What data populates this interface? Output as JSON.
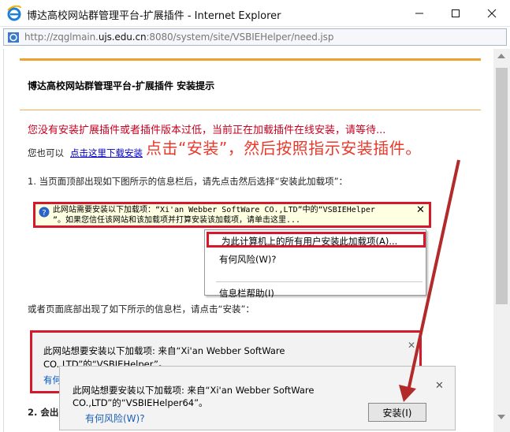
{
  "window": {
    "title": "博达高校网站群管理平台-扩展插件 - Internet Explorer",
    "address_url_prefix": "http://zqglmain.",
    "address_url_host": "ujs.edu.cn",
    "address_url_rest": ":8080/system/site/VSBIEHelper/need.jsp"
  },
  "page": {
    "header_title": "博达高校网站群管理平台-扩展插件 安装提示",
    "warning": "您没有安装扩展插件或者插件版本过低，当前正在加载插件在线安装，请等待...",
    "also_prefix": "您也可以",
    "download_link": "点击这里下载安装",
    "annotation": "点击“安装”，然后按照指示安装插件。",
    "step1": "1. 当页面顶部出现如下图所示的信息栏后，请先点击然后选择“安装此加载项”：",
    "or_bottom": "或者页面底部出现了如下所示的信息栏，请点击“安装”：",
    "step2_partial": "2. 会出"
  },
  "infobar1": {
    "line1": "此网站需要安装以下加载项：“Xi'an Webber SoftWare CO.,LTD”中的“VSBIEHelper",
    "line2": "”。如果您信任该网站和该加载项并打算安装该加载项，请单击这里...",
    "close": "✕"
  },
  "context_menu": {
    "items": [
      "为此计算机上的所有用户安装此加载项(A)...",
      "有何风险(W)?",
      "信息栏帮助(I)"
    ]
  },
  "infobar2": {
    "line1": "此网站想要安装以下加载项: 来自“Xi'an Webber SoftWare",
    "line2": "CO.,LTD”的“VSBIEHelper”。",
    "link_partial": "有何",
    "close": "✕"
  },
  "dialog": {
    "line1": "此网站想要安装以下加载项: 来自“Xi'an Webber SoftWare",
    "line2": "CO.,LTD”的“VSBIEHelper64”。",
    "risk_link": "有何风险(W)?",
    "install_button": "安装(I)",
    "close": "✕"
  },
  "colors": {
    "accent_red": "#d6182d",
    "warning_red": "#c8001e",
    "annotation_red": "#e8392b",
    "header_orange": "#f0a030",
    "arrow": "#b22a2a"
  },
  "icons": [
    "ie-logo-icon",
    "minimize-icon",
    "maximize-icon",
    "close-icon",
    "page-icon",
    "shield-icon",
    "close-icon"
  ]
}
